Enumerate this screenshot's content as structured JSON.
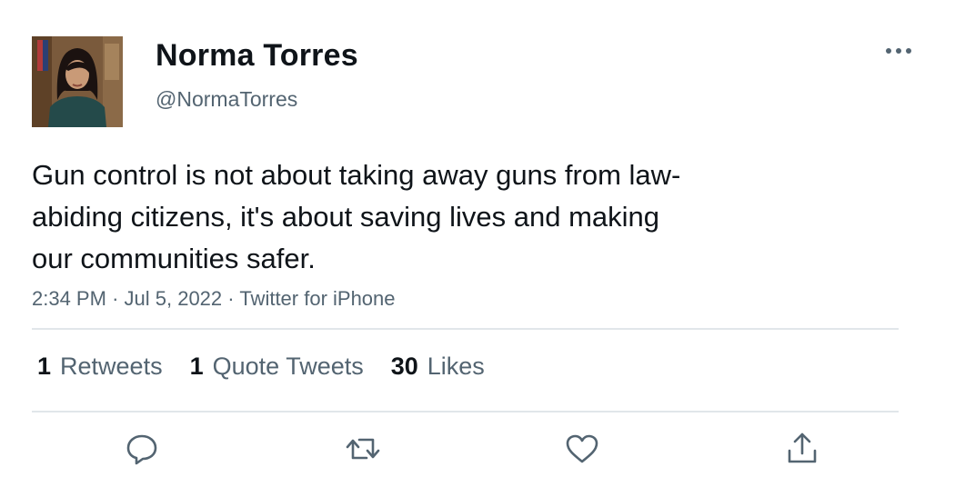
{
  "author": {
    "display_name": "Norma Torres",
    "handle": "@NormaTorres",
    "avatar_icon": "profile-photo"
  },
  "tweet": {
    "lines": [
      "Gun control is not about taking away guns from law-",
      "abiding citizens, it's about saving lives and making",
      "our communities safer."
    ]
  },
  "meta": {
    "time": "2:34 PM",
    "separator": "·",
    "date": "Jul 5, 2022",
    "source": "Twitter for iPhone"
  },
  "stats": [
    {
      "count": "1",
      "label": "Retweets"
    },
    {
      "count": "1",
      "label": "Quote Tweets"
    },
    {
      "count": "30",
      "label": "Likes"
    }
  ],
  "actions": [
    {
      "icon": "reply-icon"
    },
    {
      "icon": "retweet-icon"
    },
    {
      "icon": "like-icon"
    },
    {
      "icon": "share-icon"
    }
  ],
  "colors": {
    "text_primary": "#0f1419",
    "text_secondary": "#536471",
    "divider": "#e1e6ea"
  }
}
